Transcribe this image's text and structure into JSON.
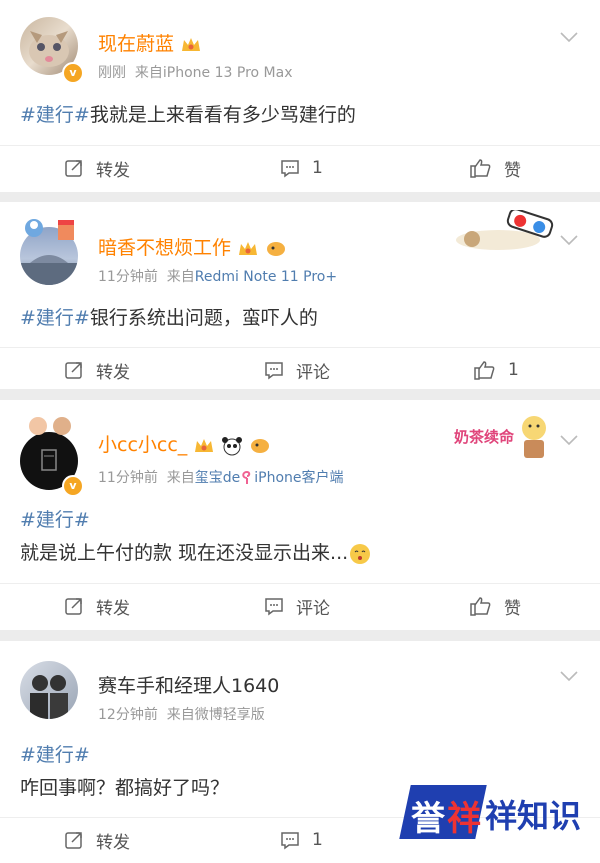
{
  "posts": [
    {
      "username": "现在蔚蓝",
      "time": "刚刚",
      "source_prefix": "来自",
      "source": "iPhone 13 Pro Max",
      "hashtag": "#建行#",
      "text": "我就是上来看看有多少骂建行的",
      "actions": {
        "repost": "转发",
        "comment": "1",
        "like": "赞"
      }
    },
    {
      "username": "暗香不想烦工作",
      "time": "11分钟前",
      "source_prefix": "来自",
      "source": "Redmi Note 11 Pro+",
      "hashtag": "#建行#",
      "text": "银行系统出问题，蛮吓人的",
      "actions": {
        "repost": "转发",
        "comment": "评论",
        "like": "1"
      }
    },
    {
      "username": "小cc小cc_",
      "time": "11分钟前",
      "source_prefix": "来自",
      "source_a": "玺宝de",
      "source_b": "iPhone客户端",
      "hashtag": "#建行#",
      "text": "就是说上午付的款 现在还没显示出来...",
      "actions": {
        "repost": "转发",
        "comment": "评论",
        "like": "赞"
      }
    },
    {
      "username": "赛车手和经理人1640",
      "time": "12分钟前",
      "source_prefix": "来自",
      "source": "微博轻享版",
      "hashtag": "#建行#",
      "text": "咋回事啊？都搞好了吗？",
      "actions": {
        "repost": "转发",
        "comment": "1"
      }
    }
  ],
  "badge_text": "奶茶续命",
  "watermark": {
    "text1": "誉",
    "text2": "祥",
    "text3": "祥知识"
  },
  "colors": {
    "username": "#ff8200",
    "link": "#507daf",
    "meta": "#999999",
    "separator": "#ececec"
  }
}
